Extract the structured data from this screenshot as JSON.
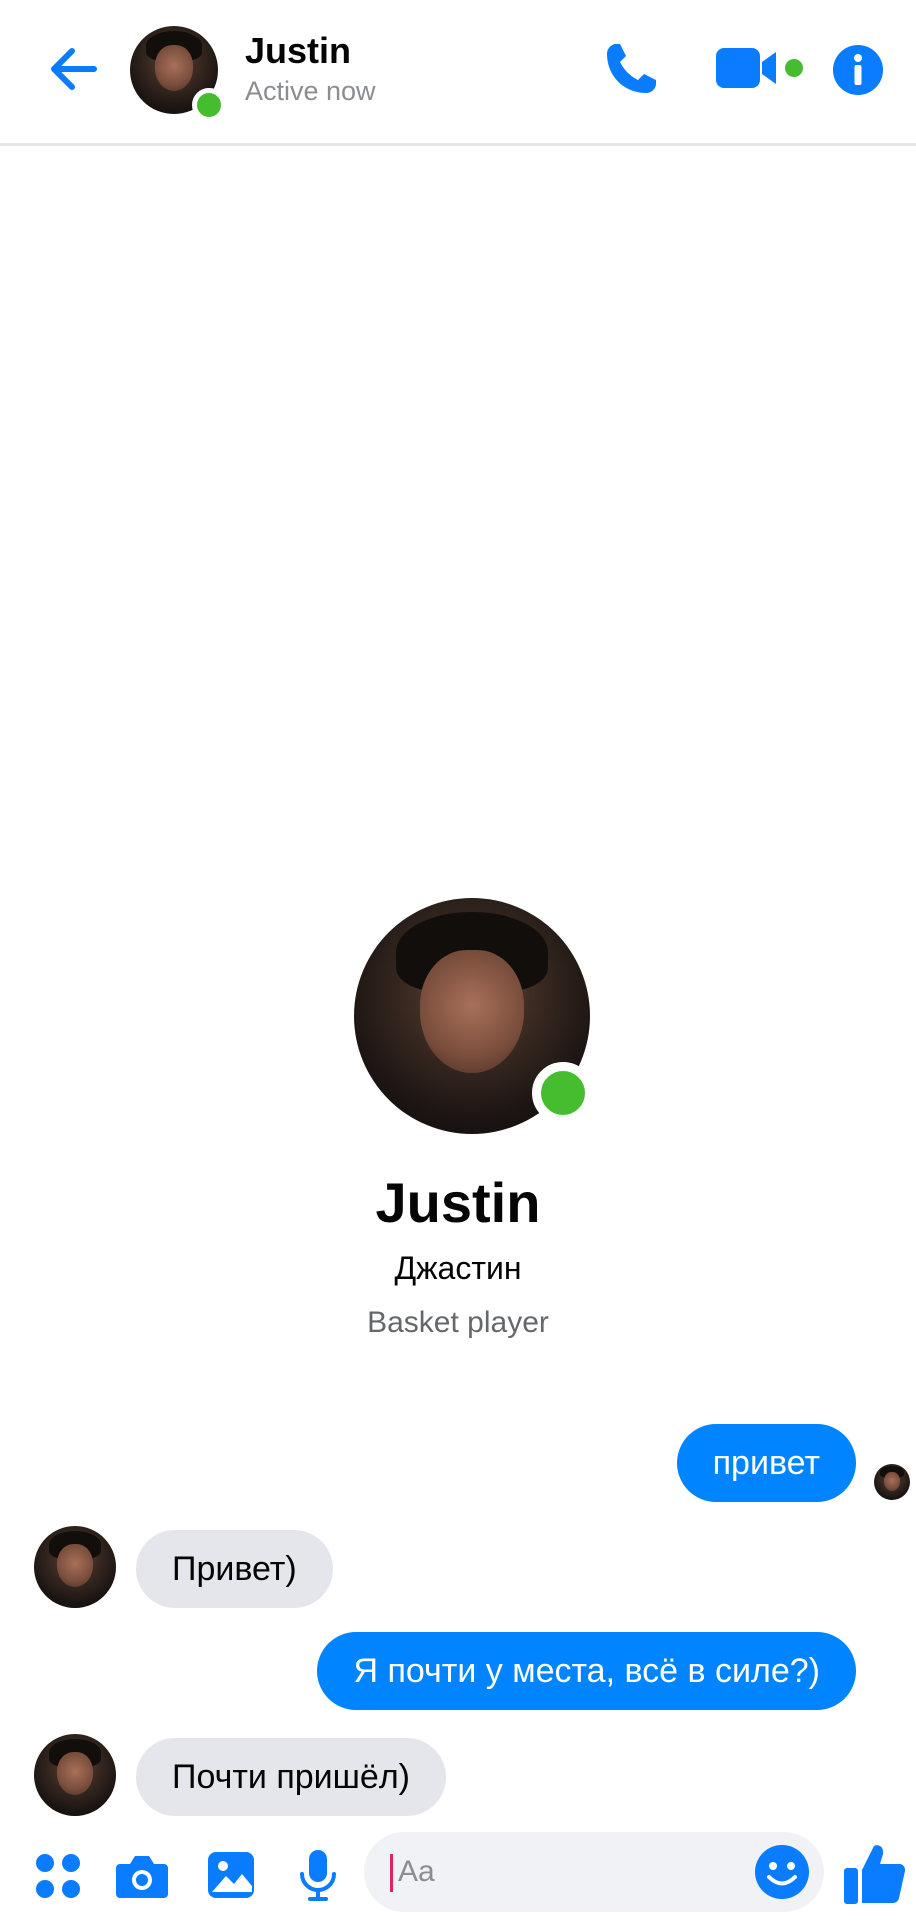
{
  "header": {
    "name": "Justin",
    "status": "Active now"
  },
  "profile": {
    "name": "Justin",
    "subtitle": "Джастин",
    "bio": "Basket player"
  },
  "messages": [
    {
      "direction": "outgoing",
      "text": "привет"
    },
    {
      "direction": "incoming",
      "text": "Привет)"
    },
    {
      "direction": "outgoing",
      "text": "Я почти у места, всё в силе?)"
    },
    {
      "direction": "incoming",
      "text": "Почти пришёл)"
    }
  ],
  "composer": {
    "placeholder": "Aa"
  },
  "colors": {
    "accent": "#0084ff",
    "online": "#45bd2e",
    "incoming_bubble": "#e4e6eb"
  }
}
